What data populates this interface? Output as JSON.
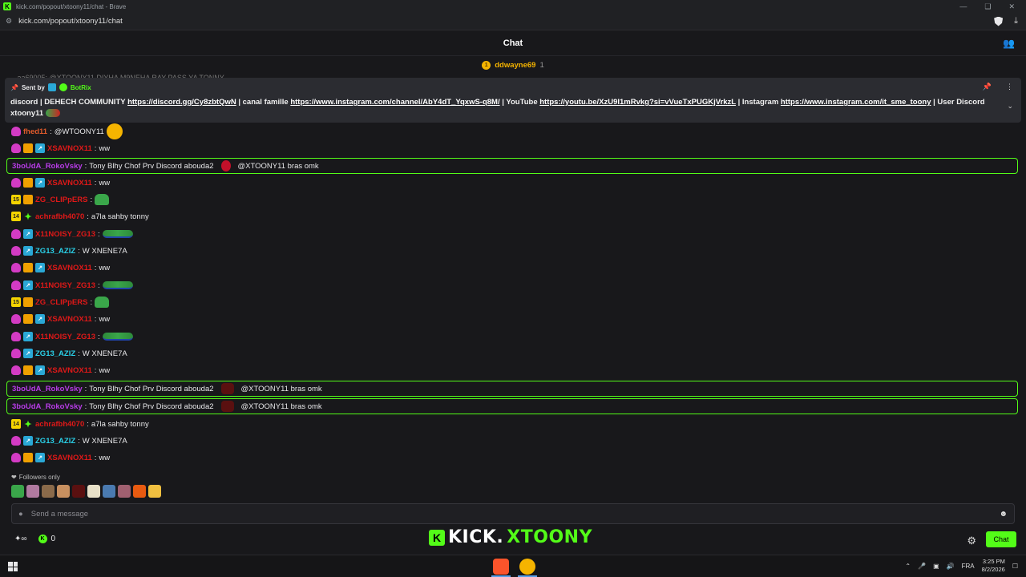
{
  "browser": {
    "window_title": "kick.com/popout/xtoony11/chat - Brave",
    "url": "kick.com/popout/xtoony11/chat"
  },
  "chat": {
    "title": "Chat",
    "top_gifter": {
      "name": "ddwayne69",
      "count": "1",
      "rank": "1"
    },
    "peek_text": "...aa69005: @XTOONY11 DIYHA M9NEHA RAY PASS YA TONNY"
  },
  "pinned": {
    "sent_by": "Sent by",
    "bot_name": "BotRix",
    "text_1": "discord | DEHECH COMMUNITY ",
    "link_1": "https://discord.gg/Cy8zbtQwN",
    "text_2": " | canal famille ",
    "link_2": "https://www.instagram.com/channel/AbY4dT_YqxwS-q8M/",
    "text_3": " | YouTube ",
    "link_3": "https://youtu.be/XzU9I1mRvkg?si=vVueTxPUGKjVrkzL",
    "text_4": " | Instagram ",
    "link_4": "https://www.instagram.com/it_sme_toony",
    "text_5": " | User Discord",
    "text_6": "xtoony11"
  },
  "messages": [
    {
      "user": "fhed11",
      "color": "#e05a2b",
      "text": "@WTOONY11",
      "badges": [
        "sub"
      ],
      "emote": "ball"
    },
    {
      "user": "XSAVNOX11",
      "color": "#e01818",
      "text": "ww",
      "badges": [
        "sub",
        "crown",
        "arrow"
      ]
    },
    {
      "user": "3boUdA_RokoVsky",
      "color": "#b83ce8",
      "text": "Tony Blhy Chof Prv Discord abouda2",
      "text2": "@XTOONY11 bras omk",
      "highlight": true,
      "emote": "red"
    },
    {
      "user": "XSAVNOX11",
      "color": "#e01818",
      "text": "ww",
      "badges": [
        "sub",
        "crown",
        "arrow"
      ]
    },
    {
      "user": "ZG_CLIPpERS",
      "color": "#e01818",
      "text": "",
      "badges": [
        "num15",
        "crown"
      ],
      "emote": "frog"
    },
    {
      "user": "achrafbh4070",
      "color": "#e01818",
      "text": "a7la sahby tonny",
      "badges": [
        "num14",
        "star"
      ]
    },
    {
      "user": "X11NOISY_ZG13",
      "color": "#e01818",
      "text": "",
      "badges": [
        "sub",
        "arrow"
      ],
      "emote": "long"
    },
    {
      "user": "ZG13_AZIZ",
      "color": "#2ad0e8",
      "text": "W XNENE7A",
      "badges": [
        "sub",
        "arrow"
      ]
    },
    {
      "user": "XSAVNOX11",
      "color": "#e01818",
      "text": "ww",
      "badges": [
        "sub",
        "crown",
        "arrow"
      ]
    },
    {
      "user": "X11NOISY_ZG13",
      "color": "#e01818",
      "text": "",
      "badges": [
        "sub",
        "arrow"
      ],
      "emote": "long"
    },
    {
      "user": "ZG_CLIPpERS",
      "color": "#e01818",
      "text": "",
      "badges": [
        "num15",
        "crown"
      ],
      "emote": "frog"
    },
    {
      "user": "XSAVNOX11",
      "color": "#e01818",
      "text": "ww",
      "badges": [
        "sub",
        "crown",
        "arrow"
      ]
    },
    {
      "user": "X11NOISY_ZG13",
      "color": "#e01818",
      "text": "",
      "badges": [
        "sub",
        "arrow"
      ],
      "emote": "long"
    },
    {
      "user": "ZG13_AZIZ",
      "color": "#2ad0e8",
      "text": "W XNENE7A",
      "badges": [
        "sub",
        "arrow"
      ]
    },
    {
      "user": "XSAVNOX11",
      "color": "#e01818",
      "text": "ww",
      "badges": [
        "sub",
        "crown",
        "arrow"
      ]
    },
    {
      "user": "3boUdA_RokoVsky",
      "color": "#b83ce8",
      "text": "Tony Blhy Chof Prv Discord abouda2",
      "text2": "@XTOONY11 bras omk",
      "highlight": true,
      "emote": "dark"
    },
    {
      "user": "3boUdA_RokoVsky",
      "color": "#b83ce8",
      "text": "Tony Blhy Chof Prv Discord abouda2",
      "text2": "@XTOONY11 bras omk",
      "highlight": true,
      "emote": "dark"
    },
    {
      "user": "achrafbh4070",
      "color": "#e01818",
      "text": "a7la sahby tonny",
      "badges": [
        "num14",
        "star"
      ]
    },
    {
      "user": "ZG13_AZIZ",
      "color": "#2ad0e8",
      "text": "W XNENE7A",
      "badges": [
        "sub",
        "arrow"
      ]
    },
    {
      "user": "XSAVNOX11",
      "color": "#e01818",
      "text": "ww",
      "badges": [
        "sub",
        "crown",
        "arrow"
      ]
    }
  ],
  "footer": {
    "followers_only": "Followers only",
    "input_placeholder": "Send a message",
    "count": "0",
    "brand_1": "KICK.",
    "brand_2": "XTOONY",
    "chat_button": "Chat"
  },
  "taskbar": {
    "language": "FRA",
    "time": "3:25 PM",
    "date": "8/2/2026"
  },
  "colors": {
    "accent": "#53fc18",
    "background": "#18181b",
    "pinned_bg": "#2b2c31"
  }
}
